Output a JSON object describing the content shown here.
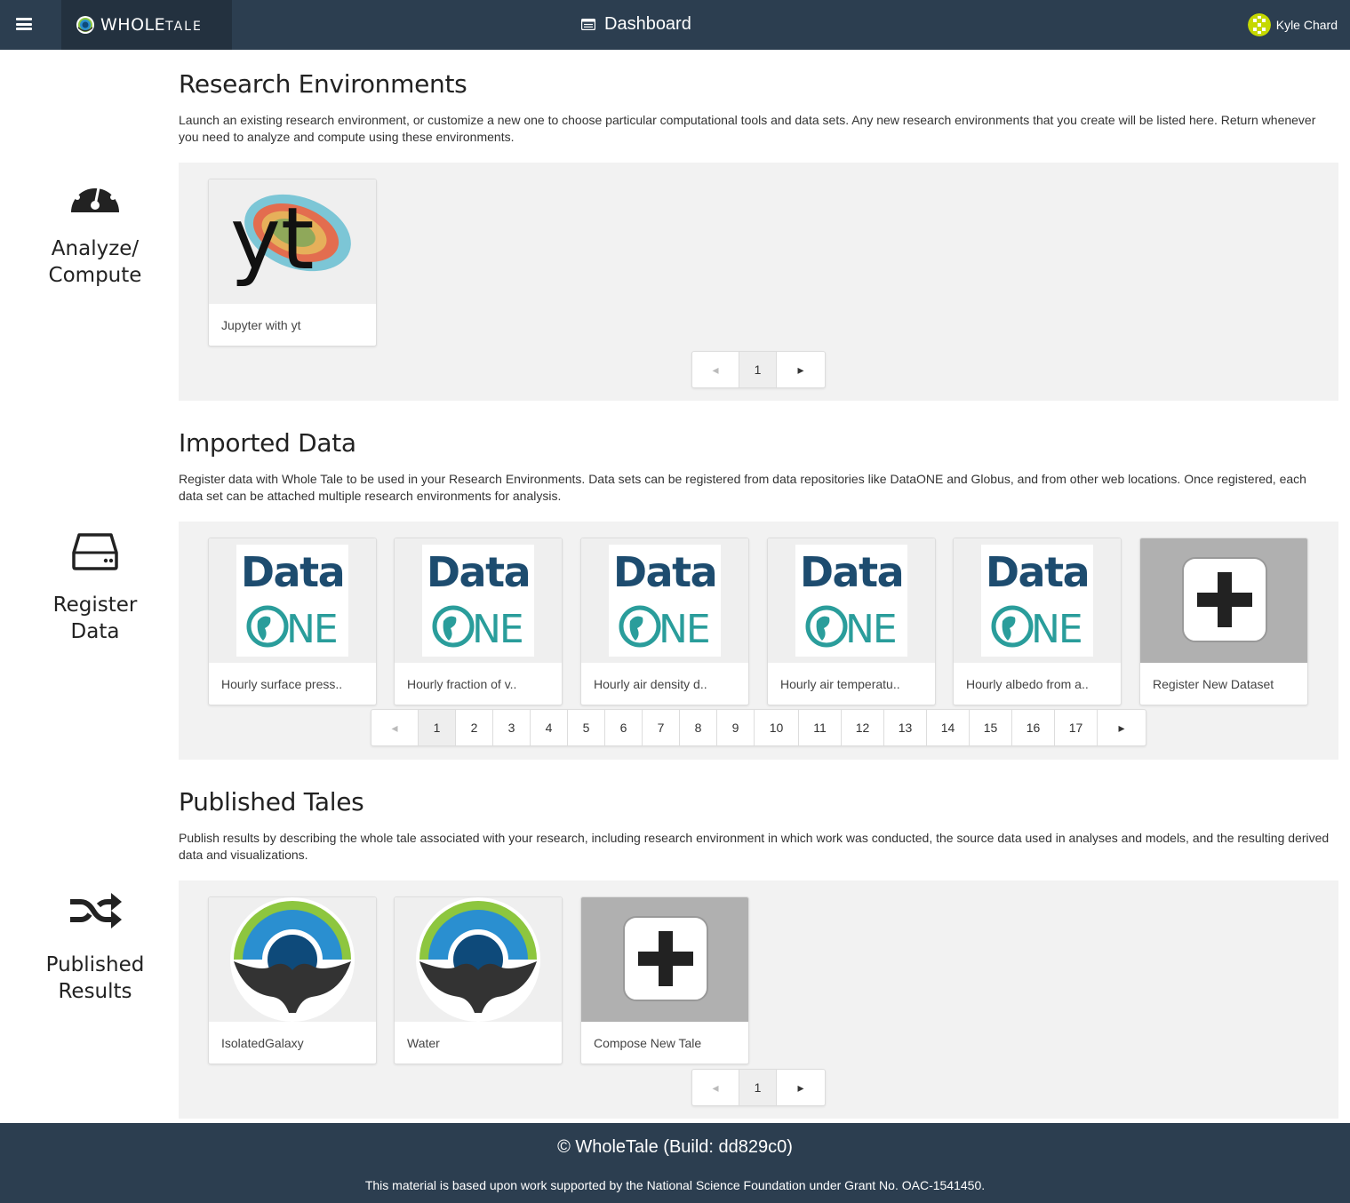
{
  "header": {
    "brand_main": "WHOLE",
    "brand_sub": "TALE",
    "page_title": "Dashboard",
    "user_name": "Kyle Chard"
  },
  "sections": {
    "environments": {
      "title": "Research Environments",
      "description": "Launch an existing research environment, or customize a new one to choose particular computational tools and data sets. Any new research environments that you create will be listed here. Return whenever you need to analyze and compute using these environments.",
      "side_label_line1": "Analyze/",
      "side_label_line2": "Compute",
      "cards": [
        {
          "label": "Jupyter with yt",
          "icon": "yt-logo"
        }
      ],
      "pager": [
        "1"
      ]
    },
    "data": {
      "title": "Imported Data",
      "description": "Register data with Whole Tale to be used in your Research Environments. Data sets can be registered from data repositories like DataONE and Globus, and from other web locations. Once registered, each data set can be attached multiple research environments for analysis.",
      "side_label_line1": "Register",
      "side_label_line2": "Data",
      "cards": [
        {
          "label": "Hourly surface press..",
          "icon": "dataone-logo"
        },
        {
          "label": "Hourly fraction of v..",
          "icon": "dataone-logo"
        },
        {
          "label": "Hourly air density d..",
          "icon": "dataone-logo"
        },
        {
          "label": "Hourly air temperatu..",
          "icon": "dataone-logo"
        },
        {
          "label": "Hourly albedo from a..",
          "icon": "dataone-logo"
        },
        {
          "label": "Register New Dataset",
          "icon": "plus-icon"
        }
      ],
      "dataone_word": "Data",
      "dataone_one": "NE",
      "pager": [
        "1",
        "2",
        "3",
        "4",
        "5",
        "6",
        "7",
        "8",
        "9",
        "10",
        "11",
        "12",
        "13",
        "14",
        "15",
        "16",
        "17"
      ]
    },
    "tales": {
      "title": "Published Tales",
      "description": "Publish results by describing the whole tale associated with your research, including research environment in which work was conducted, the source data used in analyses and models, and the resulting derived data and visualizations.",
      "side_label_line1": "Published",
      "side_label_line2": "Results",
      "cards": [
        {
          "label": "IsolatedGalaxy",
          "icon": "wholetale-logo"
        },
        {
          "label": "Water",
          "icon": "wholetale-logo"
        },
        {
          "label": "Compose New Tale",
          "icon": "plus-icon"
        }
      ],
      "pager": [
        "1"
      ]
    }
  },
  "footer": {
    "copyright": "© WholeTale (Build: dd829c0)",
    "grant": "This material is based upon work supported by the National Science Foundation under Grant No. OAC-1541450."
  },
  "colors": {
    "navbar": "#2c3e50",
    "panel": "#f2f2f2",
    "dataone_blue": "#1d4c6f",
    "dataone_teal": "#2a9d9b",
    "wt_green": "#8dc63f",
    "wt_blue": "#2a8fd0"
  }
}
